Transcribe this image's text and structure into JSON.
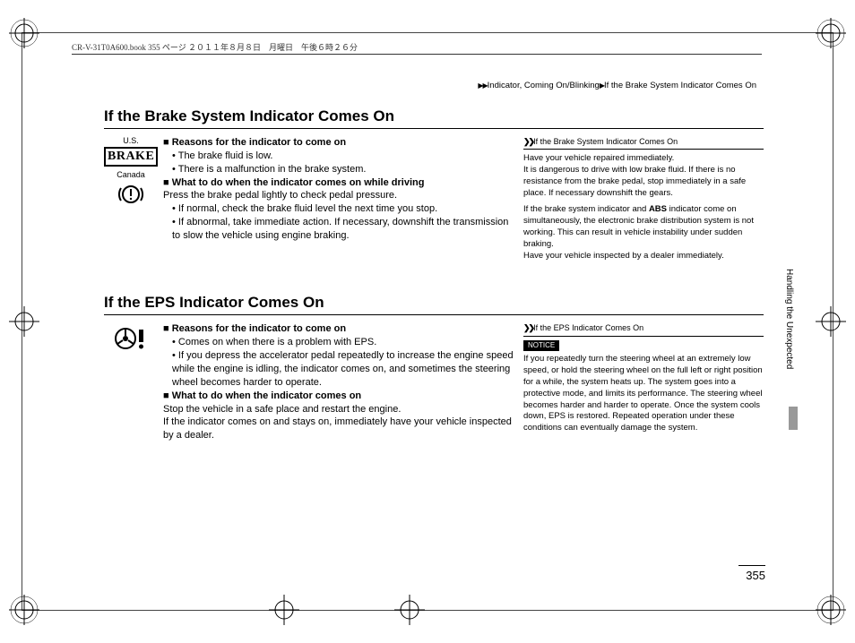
{
  "header": {
    "book_info": "CR-V-31T0A600.book  355 ページ  ２０１１年８月８日　月曜日　午後６時２６分"
  },
  "breadcrumb": {
    "arrows": "▶▶",
    "path1": "Indicator, Coming On/Blinking",
    "arrow2": "▶",
    "path2": "If the Brake System Indicator Comes On"
  },
  "section1": {
    "title": "If the Brake System Indicator Comes On",
    "icon": {
      "label_us": "U.S.",
      "brake_text": "BRAKE",
      "label_ca": "Canada"
    },
    "h1": "■ Reasons for the indicator to come on",
    "b1": "The brake fluid is low.",
    "b2": "There is a malfunction in the brake system.",
    "h2": "■ What to do when the indicator comes on while driving",
    "p1": "Press the brake pedal lightly to check pedal pressure.",
    "b3": "If normal, check the brake fluid level the next time you stop.",
    "b4": "If abnormal, take immediate action. If necessary, downshift the transmission to slow the vehicle using engine braking.",
    "side": {
      "head": "If the Brake System Indicator Comes On",
      "p1": "Have your vehicle repaired immediately.",
      "p2": "It is dangerous to drive with low brake fluid. If there is no resistance from the brake pedal, stop immediately in a safe place. If necessary downshift the gears.",
      "p3a": "If the brake system indicator and ",
      "p3b": "ABS",
      "p3c": " indicator come on simultaneously, the electronic brake distribution system is not working. This can result in vehicle instability under sudden braking.",
      "p4": "Have your vehicle inspected by a dealer immediately."
    }
  },
  "section2": {
    "title": "If the EPS Indicator Comes On",
    "h1": "■ Reasons for the indicator to come on",
    "b1": "Comes on when there is a problem with EPS.",
    "b2": "If you depress the accelerator pedal repeatedly to increase the engine speed while the engine is idling, the indicator comes on, and sometimes the steering wheel becomes harder to operate.",
    "h2": "■ What to do when the indicator comes on",
    "p1": "Stop the vehicle in a safe place and restart the engine.",
    "p2": "If the indicator comes on and stays on, immediately have your vehicle inspected by a dealer.",
    "side": {
      "head": "If the EPS Indicator Comes On",
      "notice": "NOTICE",
      "p1": "If you repeatedly turn the steering wheel at an extremely low speed, or hold the steering wheel on the full left or right position for a while, the system heats up. The system goes into a protective mode, and limits its performance. The steering wheel becomes harder and harder to operate. Once the system cools down, EPS is restored. Repeated operation under these conditions can eventually damage the system."
    }
  },
  "side_tab": "Handling the Unexpected",
  "page_number": "355"
}
